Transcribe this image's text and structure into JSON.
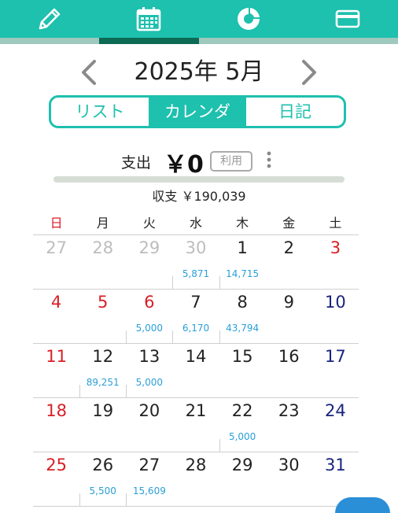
{
  "tabs": [
    {
      "name": "pencil-icon"
    },
    {
      "name": "calendar-icon",
      "active": true
    },
    {
      "name": "pie-chart-icon"
    },
    {
      "name": "card-icon"
    }
  ],
  "header": {
    "month_label": "2025年 5月"
  },
  "view_tabs": [
    "リスト",
    "カレンダ",
    "日記"
  ],
  "summary": {
    "expense_label": "支出",
    "expense_value": "￥0",
    "use_badge": "利用",
    "balance": "収支 ￥190,039"
  },
  "calendar": {
    "weekdays": [
      "日",
      "月",
      "火",
      "水",
      "木",
      "金",
      "土"
    ],
    "weeks": [
      [
        {
          "d": "27",
          "t": "gray"
        },
        {
          "d": "28",
          "t": "gray"
        },
        {
          "d": "29",
          "t": "gray"
        },
        {
          "d": "30",
          "t": "gray",
          "a": "5,871"
        },
        {
          "d": "1",
          "a": "14,715"
        },
        {
          "d": "2"
        },
        {
          "d": "3",
          "t": "red"
        }
      ],
      [
        {
          "d": "4",
          "t": "red"
        },
        {
          "d": "5",
          "t": "red"
        },
        {
          "d": "6",
          "t": "red",
          "a": "5,000"
        },
        {
          "d": "7",
          "a": "6,170"
        },
        {
          "d": "8",
          "a": "43,794"
        },
        {
          "d": "9"
        },
        {
          "d": "10",
          "t": "blue"
        }
      ],
      [
        {
          "d": "11",
          "t": "red"
        },
        {
          "d": "12",
          "a": "89,251"
        },
        {
          "d": "13",
          "a": "5,000"
        },
        {
          "d": "14"
        },
        {
          "d": "15"
        },
        {
          "d": "16"
        },
        {
          "d": "17",
          "t": "blue"
        }
      ],
      [
        {
          "d": "18",
          "t": "red"
        },
        {
          "d": "19"
        },
        {
          "d": "20"
        },
        {
          "d": "21"
        },
        {
          "d": "22",
          "a": "5,000"
        },
        {
          "d": "23"
        },
        {
          "d": "24",
          "t": "blue"
        }
      ],
      [
        {
          "d": "25",
          "t": "red"
        },
        {
          "d": "26",
          "a": "5,500"
        },
        {
          "d": "27",
          "a": "15,609"
        },
        {
          "d": "28"
        },
        {
          "d": "29"
        },
        {
          "d": "30"
        },
        {
          "d": "31",
          "t": "blue"
        }
      ]
    ]
  },
  "colors": {
    "accent": "#1ec0ae",
    "holiday": "#d81f26",
    "saturday": "#1a237e",
    "amount": "#2a9fd6"
  }
}
